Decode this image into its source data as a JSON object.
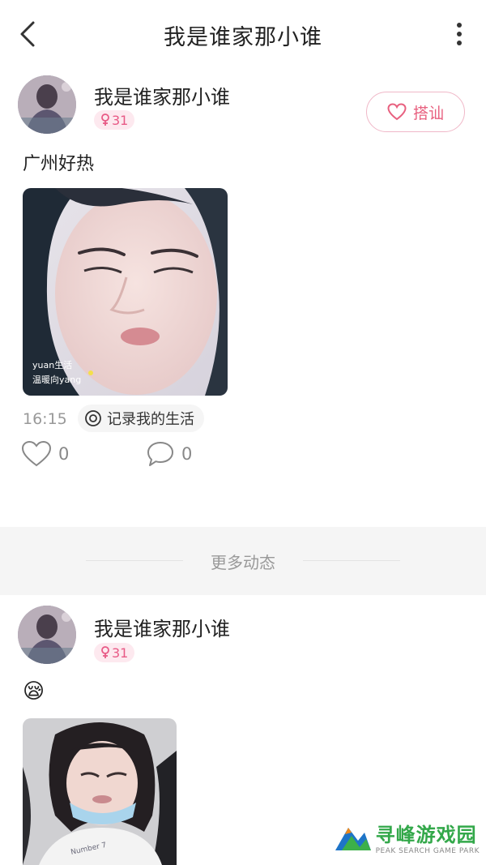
{
  "header": {
    "title": "我是谁家那小谁"
  },
  "posts": [
    {
      "username": "我是谁家那小谁",
      "age": "31",
      "follow_label": "搭讪",
      "text": "广州好热",
      "photo_caption_line1": "yuan生活",
      "photo_caption_line2": "温暖向yang",
      "time": "16:15",
      "topic": "记录我的生活",
      "like_count": "0",
      "comment_count": "0"
    },
    {
      "username": "我是谁家那小谁",
      "age": "31",
      "text": "😪"
    }
  ],
  "divider": {
    "label": "更多动态"
  },
  "watermark": {
    "title": "寻峰游戏园",
    "subtitle": "PEAK SEARCH GAME PARK"
  },
  "colors": {
    "accent_pink": "#e8607f",
    "badge_bg": "#fde9ef",
    "watermark_green": "#33a84a"
  },
  "icons": [
    "back-arrow-icon",
    "more-vertical-icon",
    "female-icon",
    "heart-icon",
    "topic-icon",
    "comment-icon"
  ]
}
